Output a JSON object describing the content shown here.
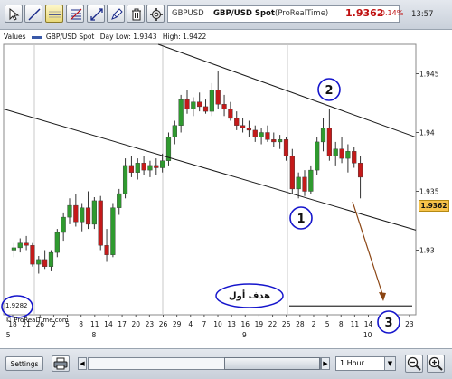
{
  "toolbar": {
    "tools": [
      {
        "name": "cursor-tool",
        "icon": "arrow-cursor-icon"
      },
      {
        "name": "trendline-tool",
        "icon": "diagonal-line-icon"
      },
      {
        "name": "horizontal-line-tool",
        "icon": "horizontal-line-icon"
      },
      {
        "name": "fibonacci-tool",
        "icon": "fibonacci-icon"
      },
      {
        "name": "parallel-channel-tool",
        "icon": "arrows-icon"
      },
      {
        "name": "pencil-tool",
        "icon": "pencil-icon"
      },
      {
        "name": "delete-tool",
        "icon": "trash-icon"
      },
      {
        "name": "settings-tool",
        "icon": "gear-icon"
      }
    ],
    "quote": {
      "symbol": "GBPUSD",
      "name": "GBP/USD Spot",
      "source": "(ProRealTime)",
      "price": "1.9362",
      "change": "-0.14%",
      "time": "13:57"
    }
  },
  "chart": {
    "values_label": "Values",
    "series_name": "GBP/USD Spot",
    "day_low": "Day Low: 1.9343",
    "day_high": "High: 1.9422",
    "current_price_tag": "1.9362",
    "left_price": "1.9282",
    "copyright": "© ProRealTime.com",
    "annotation_text": "هدف أول",
    "markers": [
      "1",
      "2",
      "3"
    ]
  },
  "chart_data": {
    "type": "candlestick",
    "ylim": [
      1.9245,
      1.9475
    ],
    "y_ticks": [
      "1.945",
      "1.94",
      "1.935",
      "1.93"
    ],
    "x_ticks": [
      "18",
      "21",
      "26",
      "2",
      "5",
      "8",
      "11",
      "14",
      "17",
      "20",
      "23",
      "26",
      "29",
      "4",
      "7",
      "10",
      "13",
      "16",
      "19",
      "22",
      "25",
      "28",
      "2",
      "5",
      "8",
      "11",
      "14",
      "17",
      "20",
      "23"
    ],
    "month_labels": [
      "5",
      "8",
      "9",
      "10"
    ],
    "candles": [
      [
        1.93,
        1.9306,
        1.9294,
        1.9302
      ],
      [
        1.9302,
        1.931,
        1.9298,
        1.9306
      ],
      [
        1.9306,
        1.9312,
        1.93,
        1.9304
      ],
      [
        1.9304,
        1.9306,
        1.9286,
        1.9288
      ],
      [
        1.9288,
        1.9295,
        1.928,
        1.9292
      ],
      [
        1.9292,
        1.93,
        1.9284,
        1.9286
      ],
      [
        1.9286,
        1.93,
        1.9282,
        1.9298
      ],
      [
        1.9298,
        1.9318,
        1.9294,
        1.9315
      ],
      [
        1.9315,
        1.9332,
        1.9308,
        1.9328
      ],
      [
        1.9328,
        1.9344,
        1.9322,
        1.9338
      ],
      [
        1.9338,
        1.9348,
        1.932,
        1.9324
      ],
      [
        1.9324,
        1.934,
        1.9316,
        1.9336
      ],
      [
        1.9336,
        1.935,
        1.9318,
        1.9322
      ],
      [
        1.9322,
        1.9345,
        1.9318,
        1.9342
      ],
      [
        1.9342,
        1.9346,
        1.93,
        1.9304
      ],
      [
        1.9304,
        1.9318,
        1.929,
        1.9296
      ],
      [
        1.9296,
        1.934,
        1.9294,
        1.9336
      ],
      [
        1.9336,
        1.9352,
        1.933,
        1.9348
      ],
      [
        1.9348,
        1.9378,
        1.9344,
        1.9372
      ],
      [
        1.9372,
        1.938,
        1.9362,
        1.9366
      ],
      [
        1.9366,
        1.9378,
        1.936,
        1.9374
      ],
      [
        1.9374,
        1.938,
        1.9364,
        1.9368
      ],
      [
        1.9368,
        1.9376,
        1.9362,
        1.9372
      ],
      [
        1.9372,
        1.9378,
        1.9364,
        1.937
      ],
      [
        1.937,
        1.9382,
        1.9366,
        1.9376
      ],
      [
        1.9376,
        1.94,
        1.9372,
        1.9396
      ],
      [
        1.9396,
        1.941,
        1.939,
        1.9406
      ],
      [
        1.9406,
        1.9432,
        1.94,
        1.9428
      ],
      [
        1.9428,
        1.9436,
        1.9416,
        1.942
      ],
      [
        1.942,
        1.943,
        1.9414,
        1.9426
      ],
      [
        1.9426,
        1.9434,
        1.9418,
        1.9422
      ],
      [
        1.9422,
        1.9428,
        1.9416,
        1.9418
      ],
      [
        1.9418,
        1.9442,
        1.9414,
        1.9436
      ],
      [
        1.9436,
        1.9452,
        1.942,
        1.9424
      ],
      [
        1.9424,
        1.9432,
        1.9414,
        1.942
      ],
      [
        1.942,
        1.9426,
        1.941,
        1.9412
      ],
      [
        1.9412,
        1.9418,
        1.9402,
        1.9406
      ],
      [
        1.9406,
        1.9412,
        1.94,
        1.9404
      ],
      [
        1.9404,
        1.941,
        1.9396,
        1.9402
      ],
      [
        1.9402,
        1.9406,
        1.9392,
        1.9396
      ],
      [
        1.9396,
        1.9404,
        1.939,
        1.94
      ],
      [
        1.94,
        1.9406,
        1.9392,
        1.9394
      ],
      [
        1.9394,
        1.94,
        1.9388,
        1.9392
      ],
      [
        1.9392,
        1.9398,
        1.9386,
        1.9394
      ],
      [
        1.9394,
        1.9396,
        1.9376,
        1.938
      ],
      [
        1.938,
        1.9386,
        1.9348,
        1.9352
      ],
      [
        1.9352,
        1.9366,
        1.9344,
        1.9362
      ],
      [
        1.9362,
        1.9368,
        1.9346,
        1.935
      ],
      [
        1.935,
        1.9372,
        1.9348,
        1.9368
      ],
      [
        1.9368,
        1.9396,
        1.9364,
        1.9392
      ],
      [
        1.9392,
        1.9412,
        1.9384,
        1.9404
      ],
      [
        1.9404,
        1.942,
        1.9376,
        1.938
      ],
      [
        1.938,
        1.9392,
        1.9372,
        1.9386
      ],
      [
        1.9386,
        1.9396,
        1.9374,
        1.9378
      ],
      [
        1.9378,
        1.939,
        1.9366,
        1.9384
      ],
      [
        1.9384,
        1.9388,
        1.937,
        1.9374
      ],
      [
        1.9374,
        1.938,
        1.9344,
        1.9362
      ]
    ],
    "channel_upper": [
      [
        0,
        1.949
      ],
      [
        1,
        1.938
      ]
    ],
    "channel_lower": [
      [
        0,
        1.9415
      ],
      [
        1,
        1.9305
      ]
    ],
    "target_line": 1.92525
  },
  "bottom": {
    "settings_label": "Settings",
    "interval_value": "1 Hour",
    "scroll_left": "◀",
    "scroll_right": "▶",
    "interval_arrow": "▼"
  },
  "colors": {
    "up": "#2f9a2f",
    "down": "#c41a1a",
    "channel": "#1a1a1a",
    "marker": "#1515cc",
    "arrow": "#8b4513",
    "price_tag": "#f7c34a"
  }
}
